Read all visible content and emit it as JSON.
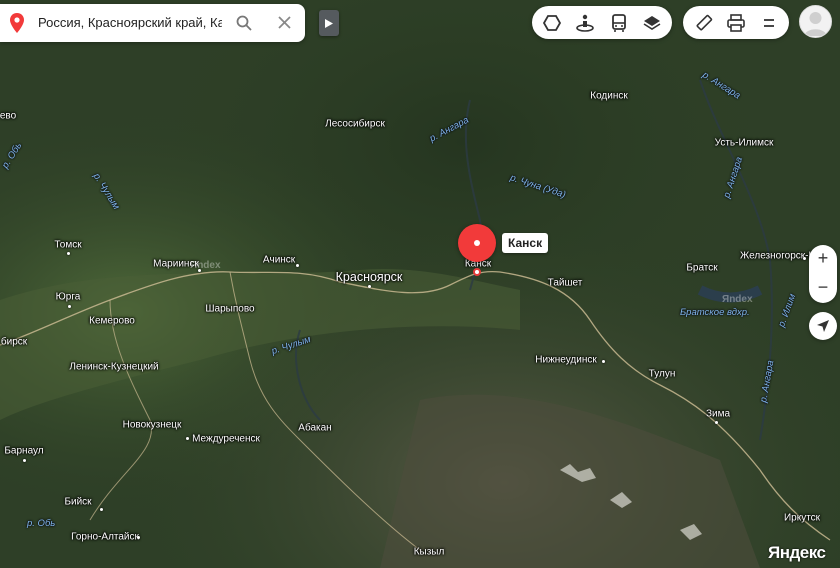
{
  "search": {
    "query": "Россия, Красноярский край, Кан"
  },
  "marker": {
    "label": "Канск"
  },
  "cities": [
    {
      "name": "Кодинск",
      "big": false
    },
    {
      "name": "Лесосибирск",
      "big": false
    },
    {
      "name": "Усть-Илимск",
      "big": false
    },
    {
      "name": "Томск",
      "big": false
    },
    {
      "name": "Мариинск",
      "big": false
    },
    {
      "name": "Ачинск",
      "big": false
    },
    {
      "name": "Красноярск",
      "big": true
    },
    {
      "name": "Канск",
      "big": false
    },
    {
      "name": "Тайшет",
      "big": false
    },
    {
      "name": "Братск",
      "big": false
    },
    {
      "name": "Железногорск-Илим",
      "big": false
    },
    {
      "name": "Юрга",
      "big": false
    },
    {
      "name": "Кемерово",
      "big": false
    },
    {
      "name": "Шарыпово",
      "big": false
    },
    {
      "name": "бирск",
      "big": false
    },
    {
      "name": "Ленинск-Кузнецкий",
      "big": false
    },
    {
      "name": "Нижнеудинск",
      "big": false
    },
    {
      "name": "Тулун",
      "big": false
    },
    {
      "name": "Новокузнецк",
      "big": false
    },
    {
      "name": "Междуреченск",
      "big": false
    },
    {
      "name": "Абакан",
      "big": false
    },
    {
      "name": "Зима",
      "big": false
    },
    {
      "name": "Барнаул",
      "big": false
    },
    {
      "name": "Бийск",
      "big": false
    },
    {
      "name": "Горно-Алтайск",
      "big": false
    },
    {
      "name": "Кызыл",
      "big": false
    },
    {
      "name": "Иркутск",
      "big": false
    },
    {
      "name": "ево",
      "big": false
    }
  ],
  "rivers": [
    {
      "name": "р. Ангара"
    },
    {
      "name": "р. Ангара"
    },
    {
      "name": "р. Ангара"
    },
    {
      "name": "р. Ангара"
    },
    {
      "name": "р. Чуна (Уда)"
    },
    {
      "name": "р. Обь"
    },
    {
      "name": "р. Чулым"
    },
    {
      "name": "р. Чулым"
    },
    {
      "name": "Братское вдхр."
    },
    {
      "name": "р. Илим"
    },
    {
      "name": "р. Обь"
    }
  ],
  "branding": {
    "logo": "Яндекс",
    "watermark": "Яndex"
  },
  "colors": {
    "marker": "#f23a3a",
    "accent": "#ffffff"
  }
}
